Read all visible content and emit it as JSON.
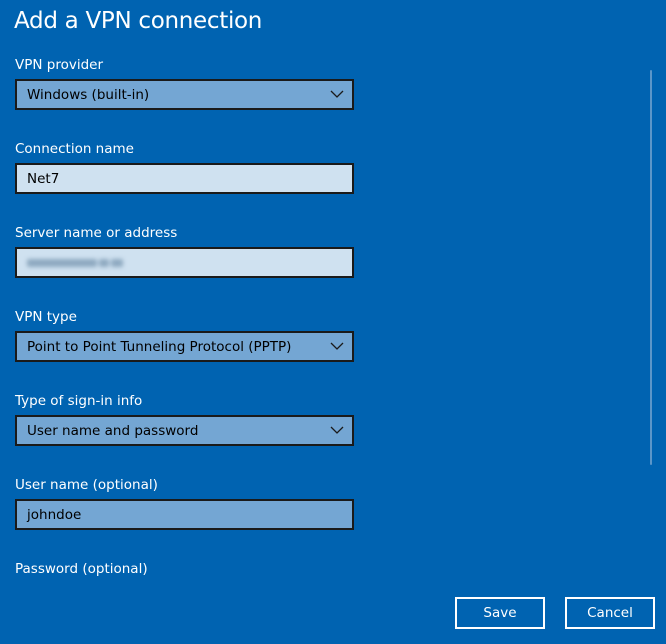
{
  "dialog": {
    "title": "Add a VPN connection"
  },
  "fields": {
    "vpn_provider": {
      "label": "VPN provider",
      "value": "Windows (built-in)"
    },
    "connection_name": {
      "label": "Connection name",
      "value": "Net7"
    },
    "server_name": {
      "label": "Server name or address",
      "value": ""
    },
    "vpn_type": {
      "label": "VPN type",
      "value": "Point to Point Tunneling Protocol (PPTP)"
    },
    "signin_type": {
      "label": "Type of sign-in info",
      "value": "User name and password"
    },
    "user_name": {
      "label": "User name (optional)",
      "value": "johndoe"
    },
    "password": {
      "label": "Password (optional)"
    }
  },
  "buttons": {
    "save_label": "Save",
    "cancel_label": "Cancel"
  },
  "icons": {
    "dropdown": "chevron-down-icon"
  },
  "colors": {
    "background": "#0063b1",
    "field_light": "#cfe1f0",
    "field_dark": "#74a6d3",
    "border": "#1a1a1a"
  }
}
